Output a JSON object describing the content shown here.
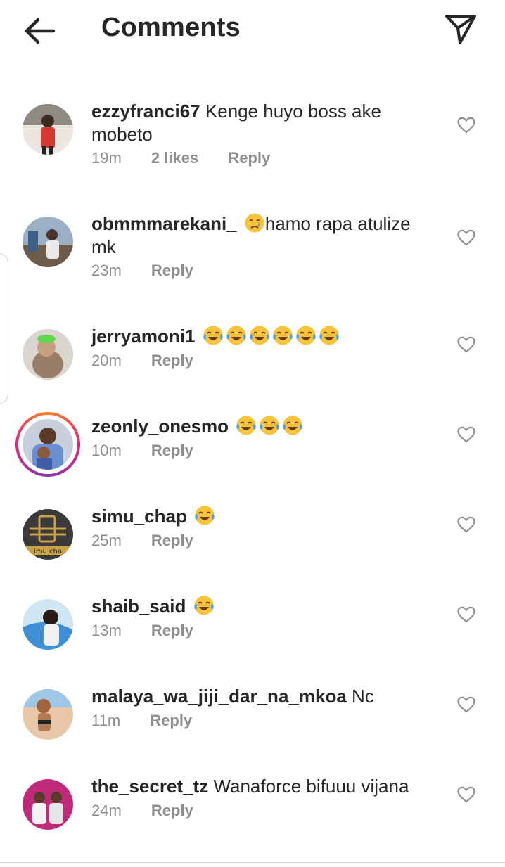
{
  "header": {
    "title": "Comments",
    "back_icon": "arrow-left-icon",
    "share_icon": "paper-plane-icon"
  },
  "comments": [
    {
      "username": "ezzyfranci67",
      "text": "Kenge huyo boss ake mobeto",
      "emojis": [],
      "time": "19m",
      "likes": "2 likes",
      "reply": "Reply",
      "avatar_color": "#c8c1b8"
    },
    {
      "username": "obmmmarekani_",
      "text": "hamo rapa atulize mk",
      "emojis": [
        "crying-face"
      ],
      "time": "23m",
      "likes": "",
      "reply": "Reply",
      "avatar_color": "#7a8ba0"
    },
    {
      "username": "jerryamoni1",
      "text": "",
      "emojis": [
        "tears-of-joy",
        "tears-of-joy",
        "tears-of-joy",
        "tears-of-joy",
        "tears-of-joy",
        "tears-of-joy"
      ],
      "time": "20m",
      "likes": "",
      "reply": "Reply",
      "avatar_color": "#b7b2a8"
    },
    {
      "username": "zeonly_onesmo",
      "text": "",
      "emojis": [
        "tears-of-joy",
        "tears-of-joy",
        "tears-of-joy"
      ],
      "time": "10m",
      "likes": "",
      "reply": "Reply",
      "avatar_color": "#9aa7c2"
    },
    {
      "username": "simu_chap",
      "text": "",
      "emojis": [
        "tears-of-joy"
      ],
      "time": "25m",
      "likes": "",
      "reply": "Reply",
      "avatar_color": "#3a3a3a",
      "avatar_text": "imu cha"
    },
    {
      "username": "shaib_said",
      "text": "",
      "emojis": [
        "tears-of-joy"
      ],
      "time": "13m",
      "likes": "",
      "reply": "Reply",
      "avatar_color": "#a9d3e6"
    },
    {
      "username": "malaya_wa_jiji_dar_na_mkoa",
      "text": "Nc",
      "emojis": [],
      "time": "11m",
      "likes": "",
      "reply": "Reply",
      "avatar_color": "#d6b59c"
    },
    {
      "username": "the_secret_tz",
      "text": "Wanaforce bifuuu vijana",
      "emojis": [],
      "time": "24m",
      "likes": "",
      "reply": "Reply",
      "avatar_color": "#c02a7a"
    }
  ],
  "colors": {
    "text": "#262626",
    "meta": "#8e8e8e",
    "story_ring": "#dd2a7b"
  }
}
